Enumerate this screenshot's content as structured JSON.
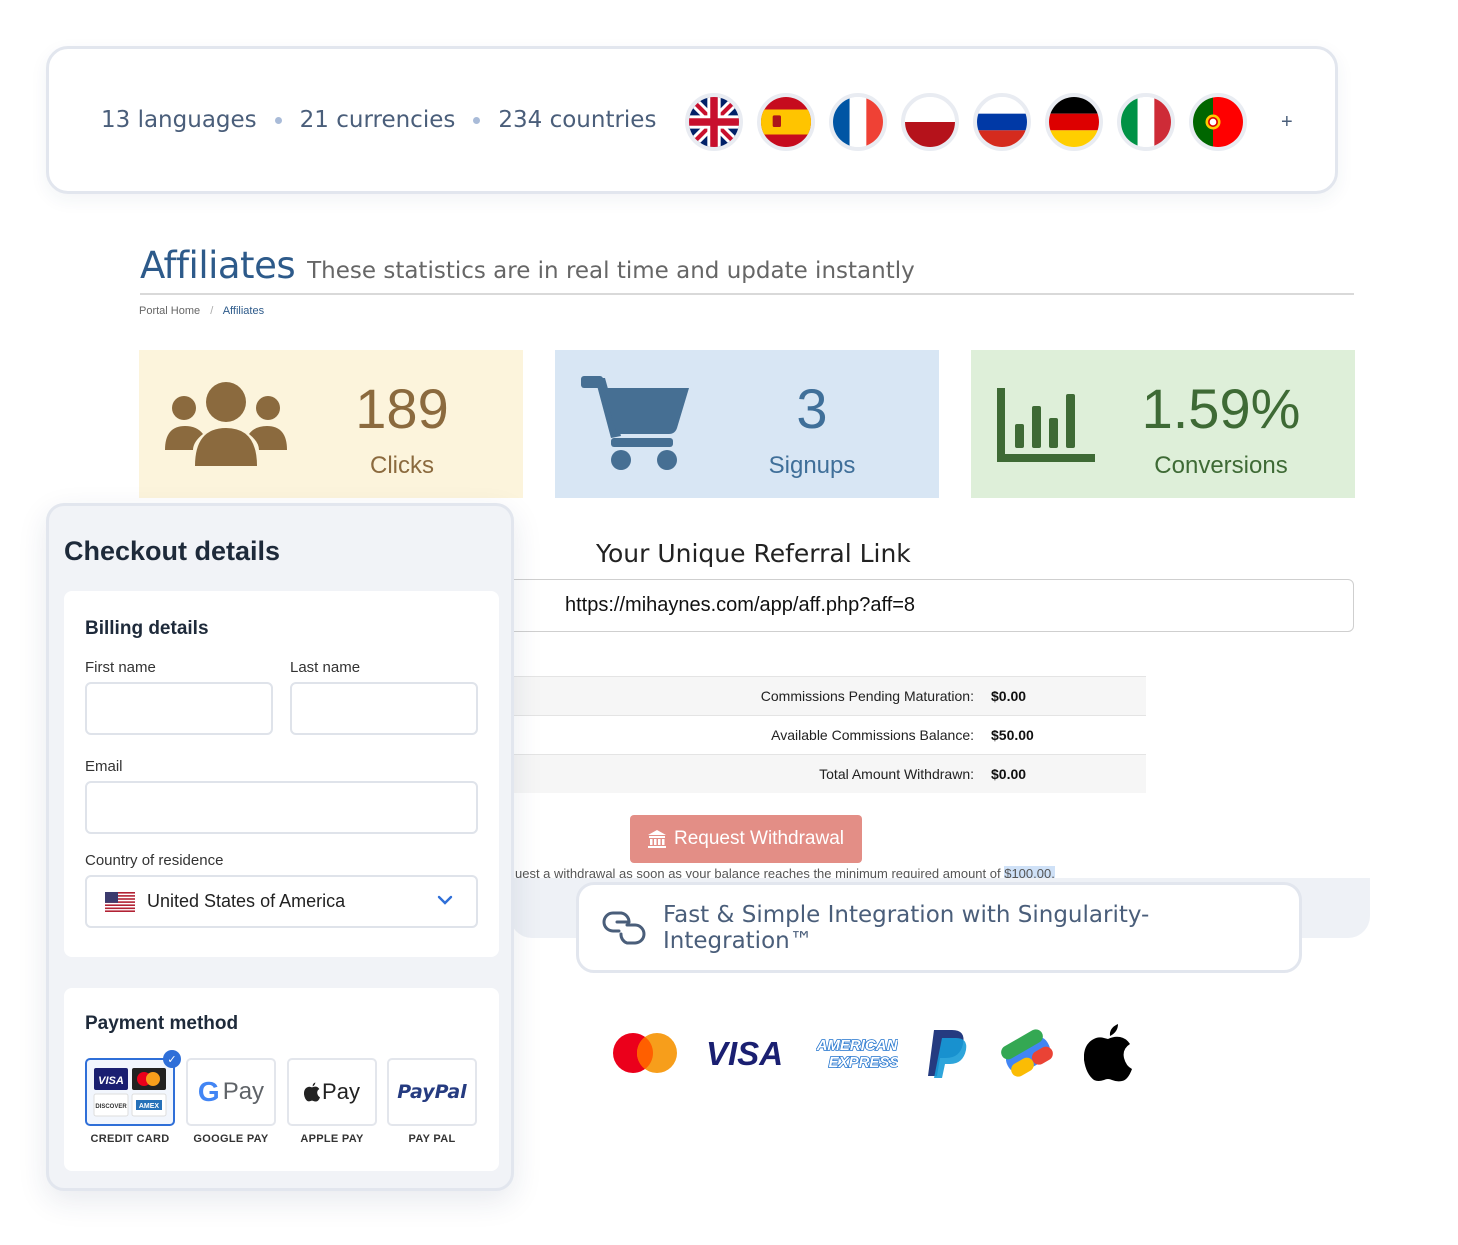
{
  "lang_card": {
    "languages": "13 languages",
    "currencies": "21 currencies",
    "countries": "234 countries",
    "flags": [
      "uk-flag",
      "spain-flag",
      "france-flag",
      "poland-flag",
      "russia-flag",
      "germany-flag",
      "italy-flag",
      "portugal-flag"
    ],
    "more": "+"
  },
  "affiliates": {
    "title": "Affiliates",
    "subtitle": "These statistics are in real time and update instantly",
    "breadcrumb": [
      "Portal Home",
      "Affiliates"
    ],
    "stats": {
      "clicks": {
        "value": "189",
        "label": "Clicks",
        "icon": "users-icon",
        "color": "#8b6a3e"
      },
      "signups": {
        "value": "3",
        "label": "Signups",
        "icon": "cart-icon",
        "color": "#3f6f99"
      },
      "conversions": {
        "value": "1.59%",
        "label": "Conversions",
        "icon": "bar-chart-icon",
        "color": "#3e6a35"
      }
    },
    "referral_title": "Your Unique Referral Link",
    "referral_link": "https://mihaynes.com/app/aff.php?aff=8",
    "commissions": [
      {
        "label": "Commissions Pending Maturation:",
        "value": "$0.00"
      },
      {
        "label": "Available Commissions Balance:",
        "value": "$50.00"
      },
      {
        "label": "Total Amount Withdrawn:",
        "value": "$0.00"
      }
    ],
    "withdraw_button": "Request Withdrawal",
    "withdraw_note": "uest a withdrawal as soon as your balance reaches the minimum required amount of",
    "withdraw_min": "$100.00."
  },
  "integration": {
    "text": "Fast & Simple Integration with Singularity-Integration™",
    "icon": "link-icon"
  },
  "payment_logos": [
    "mastercard-logo",
    "visa-logo",
    "amex-logo",
    "paypal-logo",
    "google-pay-logo",
    "apple-logo"
  ],
  "checkout": {
    "title": "Checkout details",
    "billing_title": "Billing details",
    "first_name_label": "First name",
    "last_name_label": "Last name",
    "email_label": "Email",
    "country_label": "Country of residence",
    "country_value": "United States of America",
    "payment_title": "Payment method",
    "methods": [
      "CREDIT CARD",
      "GOOGLE PAY",
      "APPLE PAY",
      "PAY PAL"
    ],
    "google_pay_text": "Pay",
    "apple_pay_text": "Pay",
    "paypal_text": "PayPal",
    "card_text": [
      "VISA",
      "DISCOVER",
      "AMEX"
    ],
    "selected_method": "CREDIT CARD"
  },
  "colors": {
    "accent": "#2d5a8a",
    "withdraw": "#e38e86",
    "clicks_bg": "#fcf4dc",
    "signups_bg": "#d8e6f4",
    "conversions_bg": "#deefd9"
  }
}
